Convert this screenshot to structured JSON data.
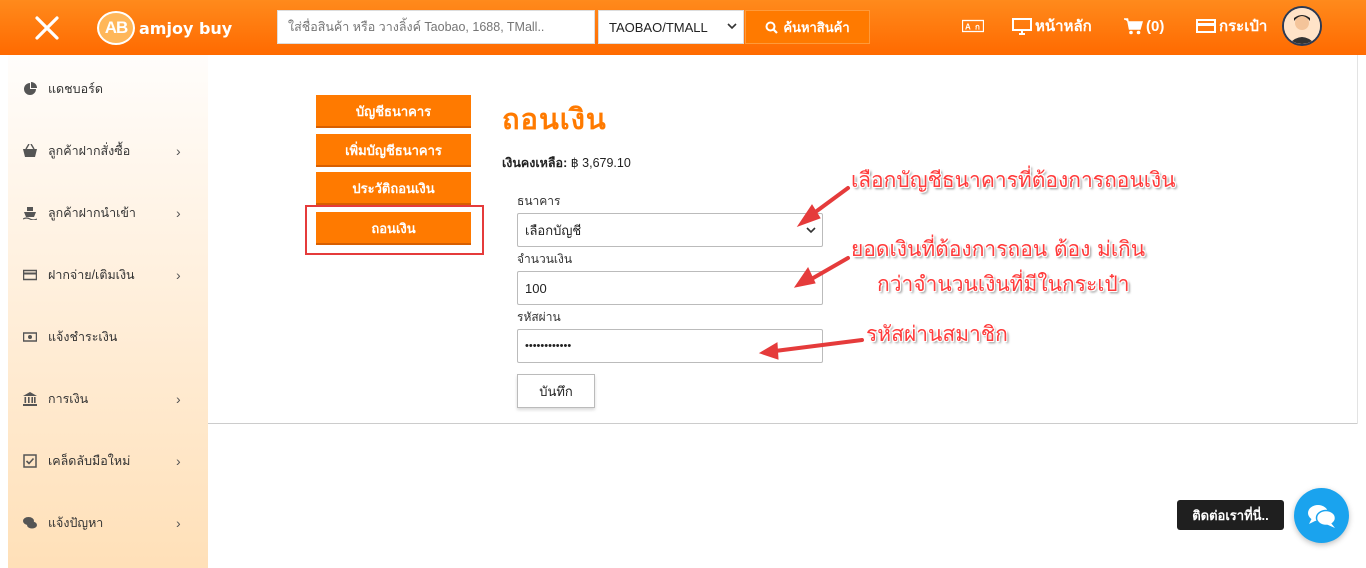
{
  "header": {
    "logo_badge": "AB",
    "logo_text": "amjoy buy",
    "search_placeholder": "ใส่ชื่อสินค้า หรือ วางลิ้งค์ Taobao, 1688, TMall..",
    "platform_selected": "TAOBAO/TMALL",
    "search_button": "ค้นหาสินค้า",
    "home_label": "หน้าหลัก",
    "cart_label": "(0)",
    "wallet_label": "กระเป๋า"
  },
  "sidebar": {
    "items": [
      {
        "label": "แดชบอร์ด",
        "icon": "pie-chart-icon",
        "has_arrow": false
      },
      {
        "label": "ลูกค้าฝากสั่งซื้อ",
        "icon": "basket-icon",
        "has_arrow": true
      },
      {
        "label": "ลูกค้าฝากนำเข้า",
        "icon": "ship-icon",
        "has_arrow": true
      },
      {
        "label": "ฝากจ่าย/เติมเงิน",
        "icon": "credit-card-icon",
        "has_arrow": true
      },
      {
        "label": "แจ้งชำระเงิน",
        "icon": "money-icon",
        "has_arrow": false
      },
      {
        "label": "การเงิน",
        "icon": "bank-icon",
        "has_arrow": true
      },
      {
        "label": "เคล็ดลับมือใหม่",
        "icon": "checkbox-icon",
        "has_arrow": true
      },
      {
        "label": "แจ้งปัญหา",
        "icon": "comments-icon",
        "has_arrow": true
      }
    ]
  },
  "tabs": [
    {
      "label": "บัญชีธนาคาร"
    },
    {
      "label": "เพิ่มบัญชีธนาคาร"
    },
    {
      "label": "ประวัติถอนเงิน"
    },
    {
      "label": "ถอนเงิน"
    }
  ],
  "main": {
    "title": "ถอนเงิน",
    "balance_label": "เงินคงเหลือ:",
    "balance_value": "฿ 3,679.10",
    "bank_label": "ธนาคาร",
    "bank_selected": "เลือกบัญชี",
    "amount_label": "จำนวนเงิน",
    "amount_value": "100",
    "password_label": "รหัสผ่าน",
    "password_value": "••••••••••••",
    "save_button": "บันทึก"
  },
  "annotations": {
    "bank_note": "เลือกบัญชีธนาคารที่ต้องการถอนเงิน",
    "amount_note_line1": "ยอดเงินที่ต้องการถอน ต้อง ม่เกิน",
    "amount_note_line2": "กว่าจำนวนเงินที่มีในกระเป๋า",
    "password_note": "รหัสผ่านสมาชิก"
  },
  "contact": {
    "label": "ติดต่อเราที่นี่.."
  },
  "colors": {
    "brand_orange": "#ff7a00",
    "annotation_red": "#ff3b3b",
    "chat_blue": "#1aa3ee"
  }
}
